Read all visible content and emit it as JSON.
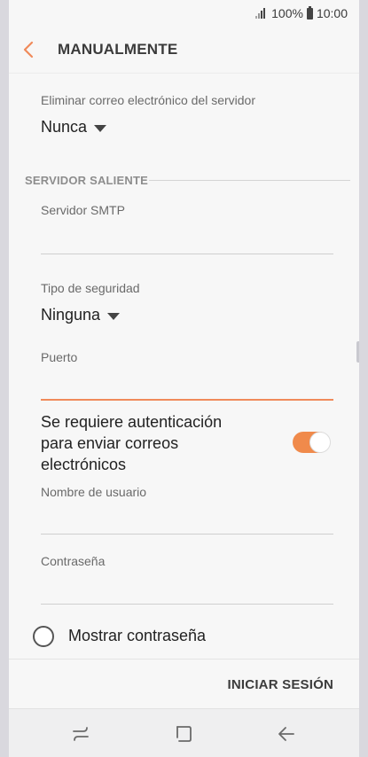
{
  "status": {
    "signal_icon": "signal-icon",
    "battery_percent": "100%",
    "battery_icon": "battery-icon",
    "time": "10:00"
  },
  "header": {
    "back_icon": "chevron-left-icon",
    "title": "MANUALMENTE"
  },
  "incoming": {
    "delete_label": "Eliminar correo electrónico del servidor",
    "delete_value": "Nunca"
  },
  "outgoing": {
    "section_title": "SERVIDOR SALIENTE",
    "smtp_label": "Servidor SMTP",
    "smtp_value": "",
    "security_label": "Tipo de seguridad",
    "security_value": "Ninguna",
    "port_label": "Puerto",
    "port_value": "",
    "auth_label": "Se requiere autenticación para enviar correos electrónicos",
    "auth_enabled": true,
    "username_label": "Nombre de usuario",
    "username_value": "",
    "password_label": "Contraseña",
    "password_value": "",
    "show_password_label": "Mostrar contraseña",
    "show_password_checked": false
  },
  "footer": {
    "signin_label": "INICIAR SESIÓN"
  },
  "nav": {
    "recent_icon": "recent-apps-icon",
    "home_icon": "home-icon",
    "back_icon": "back-arrow-icon"
  },
  "colors": {
    "accent": "#f08a4b",
    "text": "#222222",
    "muted": "#6a6a6a"
  }
}
